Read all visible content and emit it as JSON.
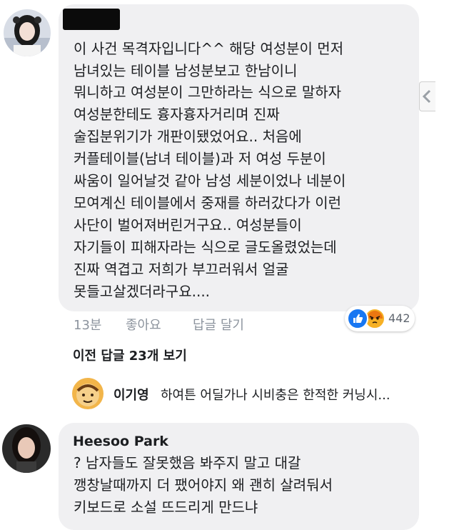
{
  "comments": [
    {
      "author": "",
      "lines": [
        "이 사건 목격자입니다^^ 해당 여성분이 먼저",
        "남녀있는 테이블 남성분보고 한남이니",
        "뭐니하고 여성분이 그만하라는 식으로 말하자",
        "여성분한테도 흉자흉자거리며 진짜",
        "술집분위기가 개판이됐었어요.. 처음에",
        "커플테이블(남녀 테이블)과 저 여성 두분이",
        "싸움이 일어날것 같아 남성 세분이었나 네분이",
        "모여계신 테이블에서 중재를 하러갔다가 이런",
        "사단이 벌어져버린거구요.. 여성분들이",
        "자기들이 피해자라는 식으로 글도올렸었는데",
        "진짜 역겹고 저희가 부끄러워서 얼굴",
        "못들고살겠더라구요...."
      ],
      "time": "13분",
      "like_label": "좋아요",
      "reply_label": "답글 달기",
      "reaction_count": "442",
      "reaction_icons": [
        "like-icon",
        "angry-icon"
      ],
      "colors": {
        "like": "#1877f2",
        "angry": "#f7b125"
      }
    },
    {
      "author": "Heesoo Park",
      "lines": [
        "? 남자들도 잘못했음 봐주지 말고 대갈",
        "깽창날때까지 더 팼어야지 왜 괜히 살려둬서",
        "키보드로 소설 뜨드리게 만드냐"
      ]
    }
  ],
  "previous_replies_label": "이전 답글 23개 보기",
  "reply_preview": {
    "name": "이기영",
    "text": "하여튼 어딜가나 시비충은 한적한 커닝시..."
  }
}
